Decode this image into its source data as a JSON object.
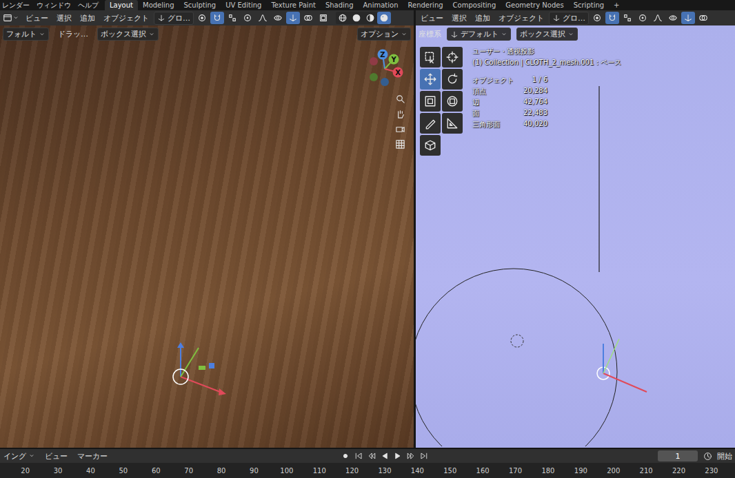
{
  "menu": [
    "レンダー",
    "ウィンドウ",
    "ヘルプ"
  ],
  "workspaces": [
    {
      "label": "Layout",
      "selected": true
    },
    {
      "label": "Modeling",
      "selected": false
    },
    {
      "label": "Sculpting",
      "selected": false
    },
    {
      "label": "UV Editing",
      "selected": false
    },
    {
      "label": "Texture Paint",
      "selected": false
    },
    {
      "label": "Shading",
      "selected": false
    },
    {
      "label": "Animation",
      "selected": false
    },
    {
      "label": "Rendering",
      "selected": false
    },
    {
      "label": "Compositing",
      "selected": false
    },
    {
      "label": "Geometry Nodes",
      "selected": false
    },
    {
      "label": "Scripting",
      "selected": false
    }
  ],
  "add_workspace": "+",
  "left_view": {
    "menus": [
      "ビュー",
      "選択",
      "追加",
      "オブジェクト"
    ],
    "orientation": "グロ…",
    "toggles": [
      {
        "kind": "pivot",
        "on": false
      },
      {
        "kind": "snap",
        "on": true
      },
      {
        "kind": "snap-target",
        "on": false
      },
      {
        "kind": "proportional",
        "on": false
      },
      {
        "kind": "falloff",
        "on": false
      },
      {
        "kind": "visibility",
        "on": false
      },
      {
        "kind": "gizmo",
        "on": true
      },
      {
        "kind": "overlay",
        "on": false
      },
      {
        "kind": "xray",
        "on": false
      }
    ],
    "shading": [
      {
        "kind": "wireframe",
        "selected": false
      },
      {
        "kind": "solid",
        "selected": false
      },
      {
        "kind": "material",
        "selected": false
      },
      {
        "kind": "rendered",
        "selected": true
      }
    ],
    "tool_settings": [
      "フォルト",
      "ドラッ…",
      "ボックス選択"
    ],
    "options": "オプション",
    "gizmo_axes": [
      "Z",
      "Y",
      "X"
    ]
  },
  "right_view": {
    "menus": [
      "ビュー",
      "選択",
      "追加",
      "オブジェクト"
    ],
    "orientation": "グロ…",
    "toggles": [
      {
        "kind": "pivot",
        "on": false
      },
      {
        "kind": "snap",
        "on": true
      },
      {
        "kind": "snap-target",
        "on": false
      },
      {
        "kind": "proportional",
        "on": false
      },
      {
        "kind": "falloff",
        "on": false
      },
      {
        "kind": "visibility",
        "on": false
      },
      {
        "kind": "gizmo",
        "on": true
      },
      {
        "kind": "overlay",
        "on": false
      }
    ],
    "coordinate_label": "座標系",
    "tool_settings": [
      "デフォルト",
      "ボックス選択"
    ],
    "view_name": "ユーザー・透視投影",
    "object_info": "(1) Collection | CLOTH_2_mesh.001 : ベース",
    "stats": [
      {
        "label": "オブジェクト",
        "value": "1 / 6"
      },
      {
        "label": "頂点",
        "value": "20,284"
      },
      {
        "label": "辺",
        "value": "42,764"
      },
      {
        "label": "面",
        "value": "22,483"
      },
      {
        "label": "三角形面",
        "value": "40,020"
      }
    ],
    "tools": [
      {
        "kind": "select",
        "selected": false
      },
      {
        "kind": "cursor",
        "selected": false
      },
      {
        "kind": "move",
        "selected": true
      },
      {
        "kind": "rotate",
        "selected": false
      },
      {
        "kind": "scale",
        "selected": false
      },
      {
        "kind": "transform",
        "selected": false
      },
      {
        "kind": "annotate",
        "selected": false
      },
      {
        "kind": "measure",
        "selected": false
      },
      {
        "kind": "add-cube",
        "selected": false
      }
    ]
  },
  "timeline": {
    "mode": "イング",
    "menus": [
      "ビュー",
      "マーカー"
    ],
    "frame": "1",
    "start_label": "開始",
    "ticks": [
      "20",
      "30",
      "40",
      "50",
      "60",
      "70",
      "80",
      "90",
      "100",
      "110",
      "120",
      "130",
      "140",
      "150",
      "160",
      "170",
      "180",
      "190",
      "200",
      "210",
      "220",
      "230"
    ]
  }
}
